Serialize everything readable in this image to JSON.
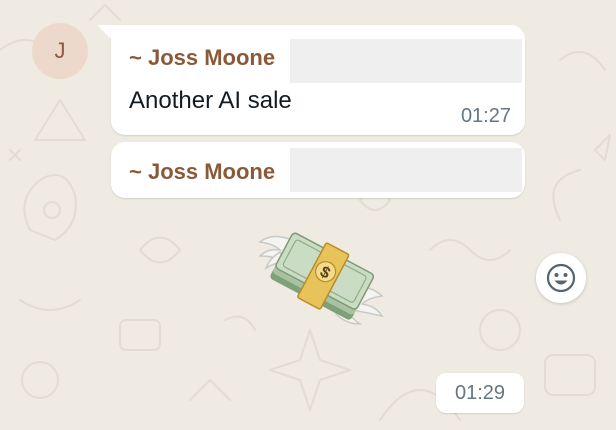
{
  "colors": {
    "chat_background": "#efeae2",
    "bubble": "#ffffff",
    "sender_name": "#8a5a38",
    "avatar_bg": "#ecd9cc",
    "timestamp": "#667781"
  },
  "avatar": {
    "initial": "J"
  },
  "messages": [
    {
      "sender": "~ Joss Moone",
      "text": "Another AI sale",
      "time": "01:27"
    },
    {
      "sender": "~ Joss Moone",
      "sticker": "money-with-wings-icon",
      "time": "01:29"
    }
  ],
  "reaction_button": {
    "icon": "smiley-icon"
  }
}
